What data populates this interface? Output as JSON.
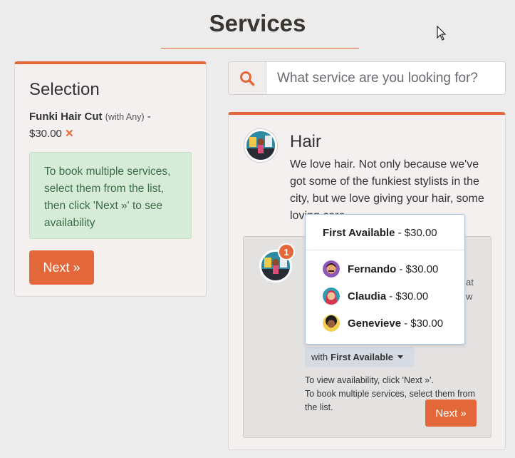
{
  "page": {
    "title": "Services"
  },
  "selection": {
    "title": "Selection",
    "item_name": "Funki Hair Cut",
    "item_with": "(with Any)",
    "item_sep": "-",
    "item_price": "$30.00",
    "remove_icon": "✕",
    "info_text": "To book multiple services, select them from the list, then click 'Next »' to see availability",
    "next_label": "Next »"
  },
  "search": {
    "placeholder": "What service are you looking for?",
    "icon": "search-icon"
  },
  "category": {
    "title": "Hair",
    "description": "We love hair. Not only because we've got some of the funkiest stylists in the city, but we love giving your hair, some loving care."
  },
  "service": {
    "badge_count": "1",
    "peek_line1": "at",
    "peek_line2": "w",
    "with_prefix": "with",
    "with_selected": "First Available",
    "note_line1": "To view availability, click 'Next »'.",
    "note_line2": "To book multiple services, select them from the list.",
    "next_label": "Next »"
  },
  "dropdown": {
    "first": {
      "label": "First Available",
      "price": "- $30.00"
    },
    "staff": [
      {
        "name": "Fernando",
        "price": "- $30.00"
      },
      {
        "name": "Claudia",
        "price": "- $30.00"
      },
      {
        "name": "Genevieve",
        "price": "- $30.00"
      }
    ]
  },
  "colors": {
    "accent": "#e2683a",
    "info_bg": "#d6ecd8",
    "page_bg": "#ececec"
  }
}
